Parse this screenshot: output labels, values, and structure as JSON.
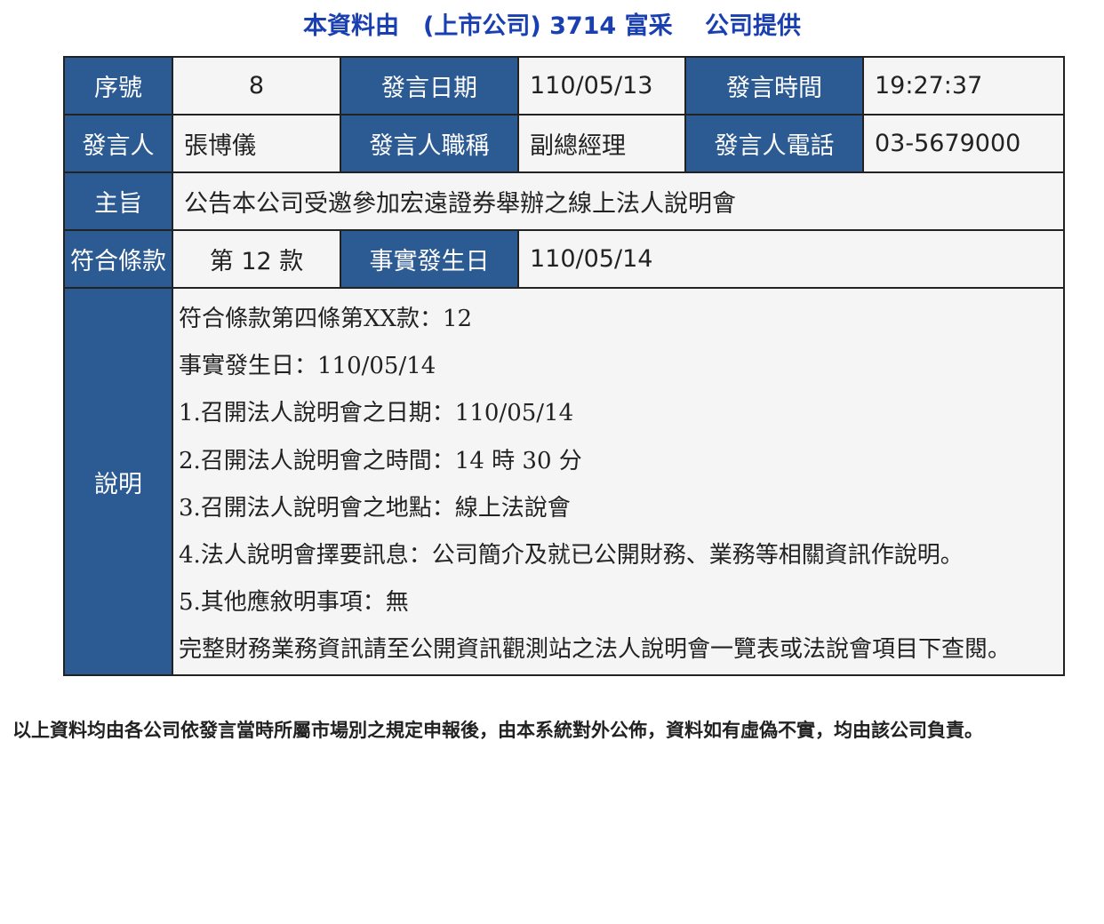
{
  "header": {
    "title": "本資料由　(上市公司) 3714 富采　 公司提供"
  },
  "rows": {
    "seq_label": "序號",
    "seq_value": "8",
    "date_label": "發言日期",
    "date_value": "110/05/13",
    "time_label": "發言時間",
    "time_value": "19:27:37",
    "speaker_label": "發言人",
    "speaker_value": "張博儀",
    "title_label": "發言人職稱",
    "title_value": "副總經理",
    "phone_label": "發言人電話",
    "phone_value": "03-5679000",
    "subject_label": "主旨",
    "subject_value": "公告本公司受邀參加宏遠證券舉辦之線上法人說明會",
    "clause_label": "符合條款",
    "clause_value": "第 12 款",
    "event_date_label": "事實發生日",
    "event_date_value": "110/05/14",
    "desc_label": "說明",
    "desc_lines": [
      "符合條款第四條第XX款：12",
      "事實發生日：110/05/14",
      "1.召開法人說明會之日期：110/05/14",
      "2.召開法人說明會之時間：14 時 30 分",
      "3.召開法人說明會之地點：線上法說會",
      "4.法人說明會擇要訊息：公司簡介及就已公開財務、業務等相關資訊作說明。",
      "5.其他應敘明事項：無",
      "完整財務業務資訊請至公開資訊觀測站之法人說明會一覽表或法說會項目下查閱。"
    ]
  },
  "footer": {
    "text": "以上資料均由各公司依發言當時所屬市場別之規定申報後，由本系統對外公佈，資料如有虛偽不實，均由該公司負責。"
  },
  "colors": {
    "header_bg": "#2c5a93",
    "cell_bg": "#f5f5f5",
    "title_blue": "#1a3fb0"
  }
}
